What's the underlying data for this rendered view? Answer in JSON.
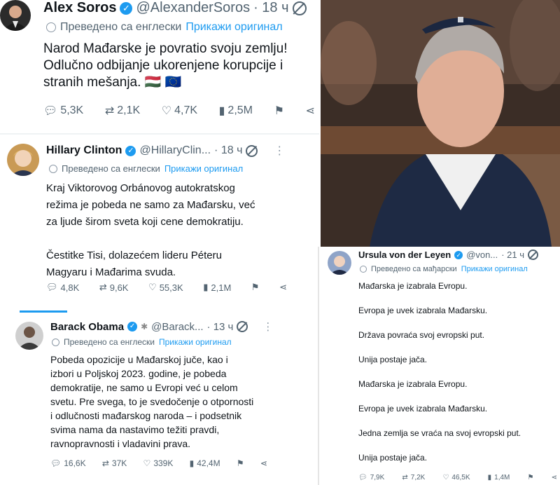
{
  "soros": {
    "name": "Alex Soros",
    "handle": "@AlexanderSoros",
    "time": "· 18 ч",
    "translated": "Преведено са енглески",
    "show_original": "Прикажи оригинал",
    "lines": [
      "Narod Mađarske je povratio svoju zemlju!",
      "Odlučno odbijanje ukorenjene korupcije i",
      "stranih mešanja. 🇭🇺 🇪🇺"
    ],
    "replies": "5,3K",
    "reposts": "2,1K",
    "likes": "4,7K",
    "views": "2,5M"
  },
  "clinton": {
    "name": "Hillary Clinton",
    "handle": "@HillaryClin...",
    "time": "· 18 ч",
    "translated": "Преведено са енглески",
    "show_original": "Прикажи оригинал",
    "lines": [
      "Kraj Viktorovog Orbánovog autokratskog",
      "režima je pobeda ne samo za Mađarsku, već",
      "za ljude širom sveta koji cene demokratiju.",
      "",
      "Čestitke Tisi, dolazećem lideru Péteru",
      "Magyaru i Mađarima svuda."
    ],
    "replies": "4,8K",
    "reposts": "9,6K",
    "likes": "55,3K",
    "views": "2,1M"
  },
  "obama": {
    "name": "Barack Obama",
    "handle": "@Barack...",
    "time": "· 13 ч",
    "translated": "Преведено са енглески",
    "show_original": "Прикажи оригинал",
    "lines": [
      "Pobeda opozicije u Mađarskoj juče, kao i",
      "izbori u Poljskoj 2023. godine, je pobeda",
      "demokratije, ne samo u Evropi već u celom",
      "svetu. Pre svega, to je svedočenje o otpornosti",
      "i odlučnosti mađarskog naroda – i podsetnik",
      "svima nama da nastavimo težiti pravdi,",
      "ravnopravnosti i vladavini prava."
    ],
    "replies": "16,6K",
    "reposts": "37K",
    "likes": "339K",
    "views": "42,4M"
  },
  "vdl": {
    "name": "Ursula von der Leyen",
    "handle": "@von...",
    "time": "· 21 ч",
    "translated": "Преведено са мађарски",
    "show_original": "Прикажи оригинал",
    "lines": [
      "Mađarska je izabrala Evropu.",
      "Evropa je uvek izabrala Mađarsku.",
      "Država povraća svoj evropski put.",
      "Unija postaje jača.",
      "Mađarska je izabrala Evropu.",
      "Evropa je uvek izabrala Mađarsku.",
      "Jedna zemlja se vraća na svoj evropski put.",
      "Unija postaje jača."
    ],
    "replies": "7,9K",
    "reposts": "7,2K",
    "likes": "46,5K",
    "views": "1,4M"
  },
  "colors": {
    "accent": "#1d9bf0",
    "muted": "#536471",
    "text": "#0f1419"
  }
}
